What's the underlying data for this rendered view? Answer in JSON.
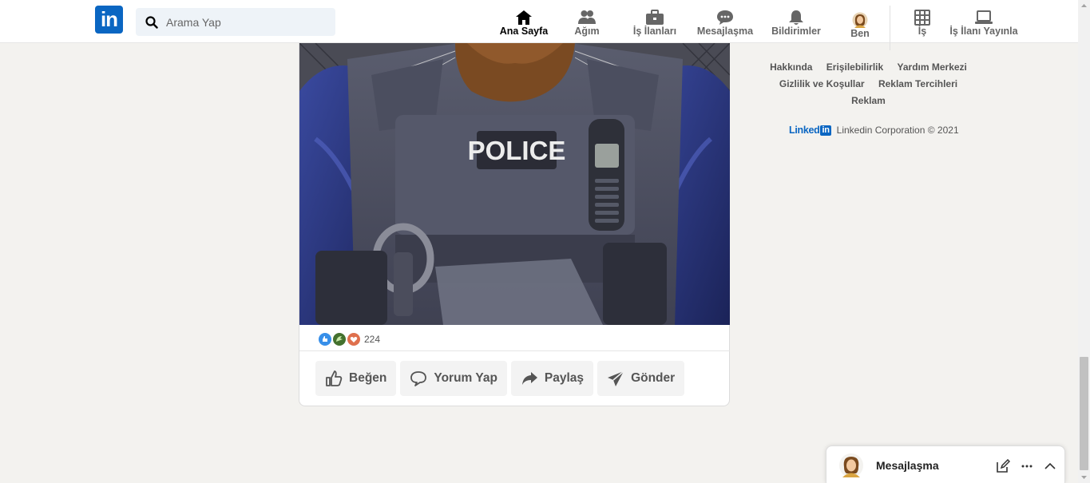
{
  "header": {
    "search_placeholder": "Arama Yap",
    "logo_text": "in",
    "nav": [
      {
        "label": "Ana Sayfa",
        "icon": "home-icon",
        "active": true
      },
      {
        "label": "Ağım",
        "icon": "network-icon"
      },
      {
        "label": "İş İlanları",
        "icon": "briefcase-icon"
      },
      {
        "label": "Mesajlaşma",
        "icon": "messaging-icon"
      },
      {
        "label": "Bildirimler",
        "icon": "bell-icon"
      },
      {
        "label": "Ben",
        "icon": "avatar"
      },
      {
        "label": "İş",
        "icon": "grid-icon"
      },
      {
        "label": "İş İlanı Yayınla",
        "icon": "laptop-icon"
      }
    ]
  },
  "post": {
    "image_text": "POLICE",
    "reaction_count": "224",
    "actions": [
      {
        "label": "Beğen",
        "icon": "like-icon"
      },
      {
        "label": "Yorum Yap",
        "icon": "comment-icon"
      },
      {
        "label": "Paylaş",
        "icon": "share-icon"
      },
      {
        "label": "Gönder",
        "icon": "send-icon"
      }
    ]
  },
  "footer": {
    "links": [
      "Hakkında",
      "Erişilebilirlik",
      "Yardım Merkezi",
      "Gizlilik ve Koşullar",
      "Reklam Tercihleri",
      "Reklam"
    ],
    "brand_word": "Linked",
    "brand_box": "in",
    "copyright": "Linkedin Corporation © 2021"
  },
  "messaging": {
    "title": "Mesajlaşma"
  },
  "colors": {
    "brand": "#0a66c2",
    "background": "#f3f2ef"
  }
}
